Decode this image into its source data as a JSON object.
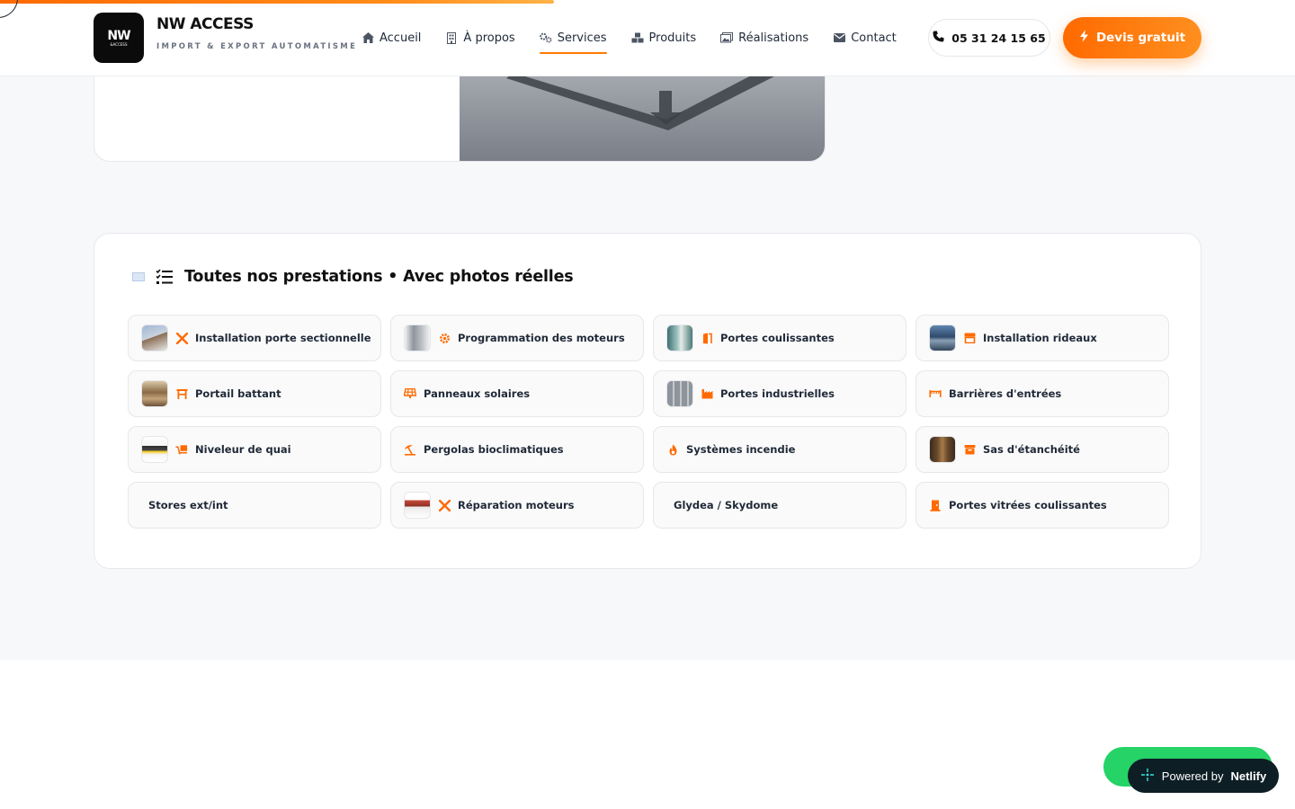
{
  "header": {
    "logo_text": "NW",
    "logo_subtext": "&ACCESS",
    "brand_name": "NW ACCESS",
    "brand_tagline": "IMPORT & EXPORT AUTOMATISME",
    "nav": [
      {
        "label": "Accueil",
        "icon": "home-icon"
      },
      {
        "label": "À propos",
        "icon": "building-icon"
      },
      {
        "label": "Services",
        "icon": "gears-icon",
        "active": true
      },
      {
        "label": "Produits",
        "icon": "boxes-icon"
      },
      {
        "label": "Réalisations",
        "icon": "images-icon"
      },
      {
        "label": "Contact",
        "icon": "envelope-icon"
      }
    ],
    "phone": "05 31 24 15 65",
    "cta": "Devis gratuit",
    "accent_color": "#ff7a00"
  },
  "services": {
    "title": "Toutes nos prestations • Avec photos réelles",
    "items": [
      {
        "label": "Installation porte sectionnelle",
        "thumb": true,
        "icon": "tools-icon"
      },
      {
        "label": "Programmation des moteurs",
        "thumb": true,
        "icon": "gear-icon"
      },
      {
        "label": "Portes coulissantes",
        "thumb": true,
        "icon": "door-open-icon"
      },
      {
        "label": "Installation rideaux",
        "thumb": true,
        "icon": "store-icon"
      },
      {
        "label": "Portail battant",
        "thumb": true,
        "icon": "gate-icon"
      },
      {
        "label": "Panneaux solaires",
        "thumb": false,
        "icon": "solar-panel-icon"
      },
      {
        "label": "Portes industrielles",
        "thumb": true,
        "icon": "industry-icon"
      },
      {
        "label": "Barrières d'entrées",
        "thumb": false,
        "icon": "barrier-icon"
      },
      {
        "label": "Niveleur de quai",
        "thumb": true,
        "icon": "dolly-icon"
      },
      {
        "label": "Pergolas bioclimatiques",
        "thumb": false,
        "icon": "umbrella-beach-icon"
      },
      {
        "label": "Systèmes incendie",
        "thumb": false,
        "icon": "fire-icon"
      },
      {
        "label": "Sas d'étanchéité",
        "thumb": true,
        "icon": "box-icon"
      },
      {
        "label": "Stores ext/int",
        "thumb": false,
        "icon": ""
      },
      {
        "label": "Réparation moteurs",
        "thumb": true,
        "icon": "tools-icon"
      },
      {
        "label": "Glydea / Skydome",
        "thumb": false,
        "icon": ""
      },
      {
        "label": "Portes vitrées coulissantes",
        "thumb": false,
        "icon": "door-closed-icon"
      }
    ]
  },
  "netlify": {
    "prefix": "Powered by",
    "brand": "Netlify"
  }
}
